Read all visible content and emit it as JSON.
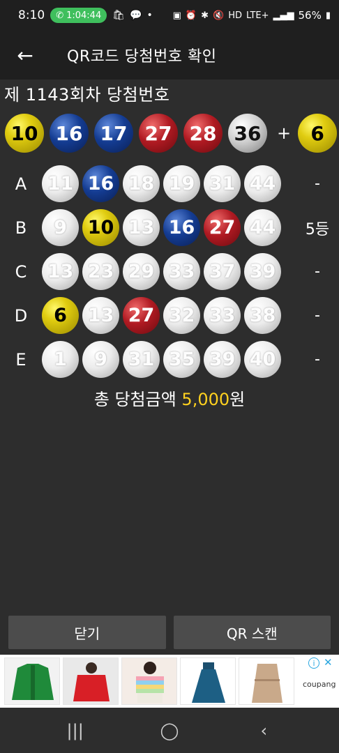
{
  "status": {
    "time": "8:10",
    "call_time": "1:04:44",
    "battery": "56%",
    "network": "LTE+",
    "hd": "HD"
  },
  "appbar": {
    "title": "QR코드 당첨번호 확인"
  },
  "draw": {
    "title": "제 1143회차 당첨번호",
    "numbers": [
      {
        "n": "10",
        "color": "yellow"
      },
      {
        "n": "16",
        "color": "blue"
      },
      {
        "n": "17",
        "color": "blue"
      },
      {
        "n": "27",
        "color": "red"
      },
      {
        "n": "28",
        "color": "red"
      },
      {
        "n": "36",
        "color": "gray"
      }
    ],
    "plus": "+",
    "bonus": {
      "n": "6",
      "color": "yellow"
    }
  },
  "games": [
    {
      "label": "A",
      "result": "-",
      "balls": [
        {
          "n": "11",
          "color": "white"
        },
        {
          "n": "16",
          "color": "blue"
        },
        {
          "n": "18",
          "color": "white"
        },
        {
          "n": "19",
          "color": "white"
        },
        {
          "n": "31",
          "color": "white"
        },
        {
          "n": "44",
          "color": "white"
        }
      ]
    },
    {
      "label": "B",
      "result": "5등",
      "balls": [
        {
          "n": "9",
          "color": "white"
        },
        {
          "n": "10",
          "color": "yellow"
        },
        {
          "n": "13",
          "color": "white"
        },
        {
          "n": "16",
          "color": "blue"
        },
        {
          "n": "27",
          "color": "red"
        },
        {
          "n": "44",
          "color": "white"
        }
      ]
    },
    {
      "label": "C",
      "result": "-",
      "balls": [
        {
          "n": "13",
          "color": "white"
        },
        {
          "n": "23",
          "color": "white"
        },
        {
          "n": "29",
          "color": "white"
        },
        {
          "n": "33",
          "color": "white"
        },
        {
          "n": "37",
          "color": "white"
        },
        {
          "n": "39",
          "color": "white"
        }
      ]
    },
    {
      "label": "D",
      "result": "-",
      "balls": [
        {
          "n": "6",
          "color": "yellow"
        },
        {
          "n": "13",
          "color": "white"
        },
        {
          "n": "27",
          "color": "red"
        },
        {
          "n": "32",
          "color": "white"
        },
        {
          "n": "33",
          "color": "white"
        },
        {
          "n": "38",
          "color": "white"
        }
      ]
    },
    {
      "label": "E",
      "result": "-",
      "balls": [
        {
          "n": "1",
          "color": "white"
        },
        {
          "n": "9",
          "color": "white"
        },
        {
          "n": "31",
          "color": "white"
        },
        {
          "n": "35",
          "color": "white"
        },
        {
          "n": "39",
          "color": "white"
        },
        {
          "n": "40",
          "color": "white"
        }
      ]
    }
  ],
  "total": {
    "prefix": "총 당첨금액 ",
    "amount": "5,000",
    "suffix": "원"
  },
  "buttons": {
    "close": "닫기",
    "qr_scan": "QR 스캔"
  },
  "ad": {
    "brand": "coupang",
    "info_icon": "info-icon",
    "close_icon": "close-icon"
  },
  "navbar": {
    "recents": "|||",
    "home": "◯",
    "back": "‹"
  },
  "colors": {
    "yellow": "#e0cc10",
    "blue": "#143c92",
    "red": "#b01a22",
    "gray": "#cfcfcf",
    "amount": "#ffd11f"
  }
}
